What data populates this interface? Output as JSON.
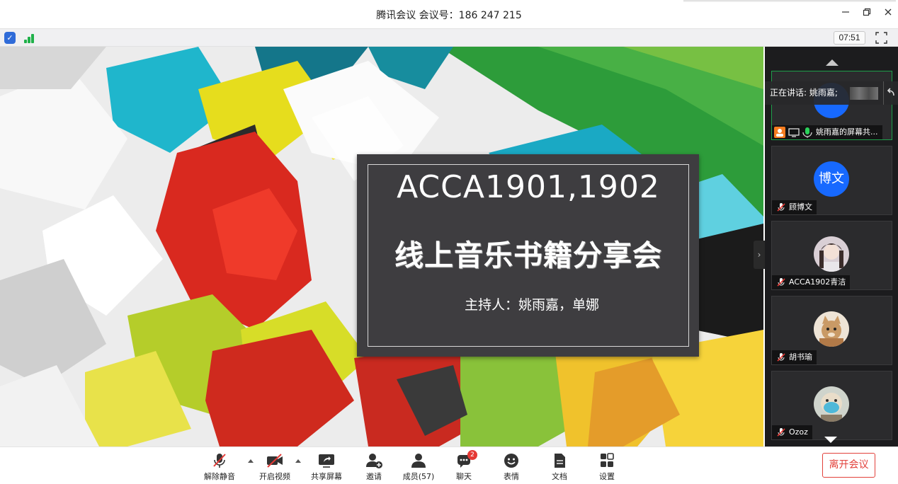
{
  "window": {
    "title": "腾讯会议 会议号：186 247 215",
    "min_icon": "minimize-icon",
    "max_icon": "restore-icon",
    "close_icon": "close-icon"
  },
  "infobar": {
    "shield_icon": "shield-icon",
    "signal_icon": "signal-strength-icon",
    "elapsed_time": "07:51",
    "fullscreen_icon": "fullscreen-icon"
  },
  "slide": {
    "title_line1": "ACCA1901,1902",
    "title_line2": "线上音乐书籍分享会",
    "host_line": "主持人：姚雨嘉，单娜"
  },
  "sidebar": {
    "speaking_label": "正在讲话: 姚雨嘉;",
    "participants": [
      {
        "name": "姚雨嘉的屏幕共...",
        "avatar_text": "",
        "avatar_type": "initials"
      },
      {
        "name": "顾博文",
        "avatar_text": "博文",
        "avatar_type": "initials"
      },
      {
        "name": "ACCA1902青洁",
        "avatar_text": "",
        "avatar_type": "photo"
      },
      {
        "name": "胡书瑜",
        "avatar_text": "",
        "avatar_type": "photo"
      },
      {
        "name": "Ozoz",
        "avatar_text": "",
        "avatar_type": "photo"
      }
    ]
  },
  "toolbar": {
    "unmute_label": "解除静音",
    "video_label": "开启视频",
    "share_label": "共享屏幕",
    "invite_label": "邀请",
    "members_label": "成员(57)",
    "chat_label": "聊天",
    "chat_badge": "2",
    "emoji_label": "表情",
    "docs_label": "文档",
    "settings_label": "设置",
    "leave_label": "离开会议"
  },
  "colors": {
    "accent_green": "#1e9e4a",
    "leave_red": "#e2413b",
    "avatar_blue": "#1769ff",
    "panel_dark": "#1c1c1e"
  }
}
